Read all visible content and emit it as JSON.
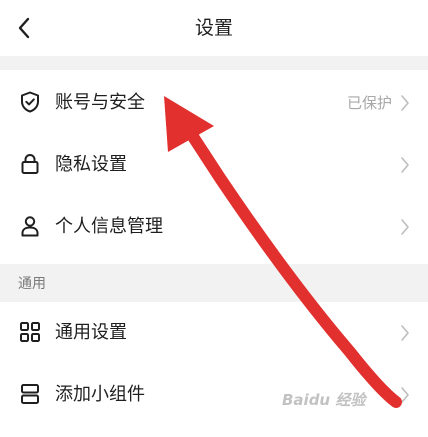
{
  "header": {
    "title": "设置"
  },
  "rows": [
    {
      "label": "账号与安全",
      "value": "已保护",
      "icon": "shield-check-icon"
    },
    {
      "label": "隐私设置",
      "icon": "lock-icon"
    },
    {
      "label": "个人信息管理",
      "icon": "person-icon"
    },
    {
      "label": "通用设置",
      "icon": "grid-icon"
    },
    {
      "label": "添加小组件",
      "icon": "widget-icon"
    }
  ],
  "section": {
    "general_label": "通用"
  },
  "overlay": {
    "arrow_color": "#e2302f",
    "watermark_text": "Baidu 经验"
  },
  "colors": {
    "background": "#ffffff",
    "separator": "#f2f2f2",
    "text_primary": "#1f1f1f",
    "text_secondary": "#a8a8a8"
  }
}
